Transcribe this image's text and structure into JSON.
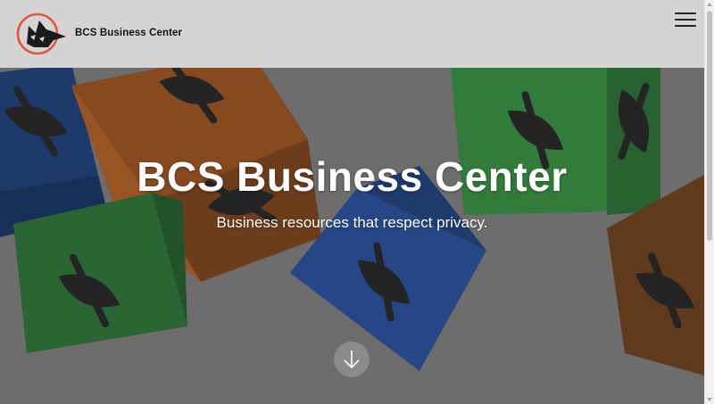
{
  "header": {
    "brand": "BCS Business Center",
    "logo_icon": "wolf-logo-icon",
    "menu_icon": "hamburger-menu-icon"
  },
  "hero": {
    "title": "BCS Business Center",
    "subtitle": "Business resources that respect privacy.",
    "scroll_icon": "arrow-down-icon",
    "background": "privacy-eye-cubes-image"
  },
  "colors": {
    "header_bg": "#d4d4d4",
    "logo_ring": "#e2583d",
    "cube_blue": "#1f4b9a",
    "cube_orange": "#b9601f",
    "cube_green": "#2f8f3c"
  }
}
